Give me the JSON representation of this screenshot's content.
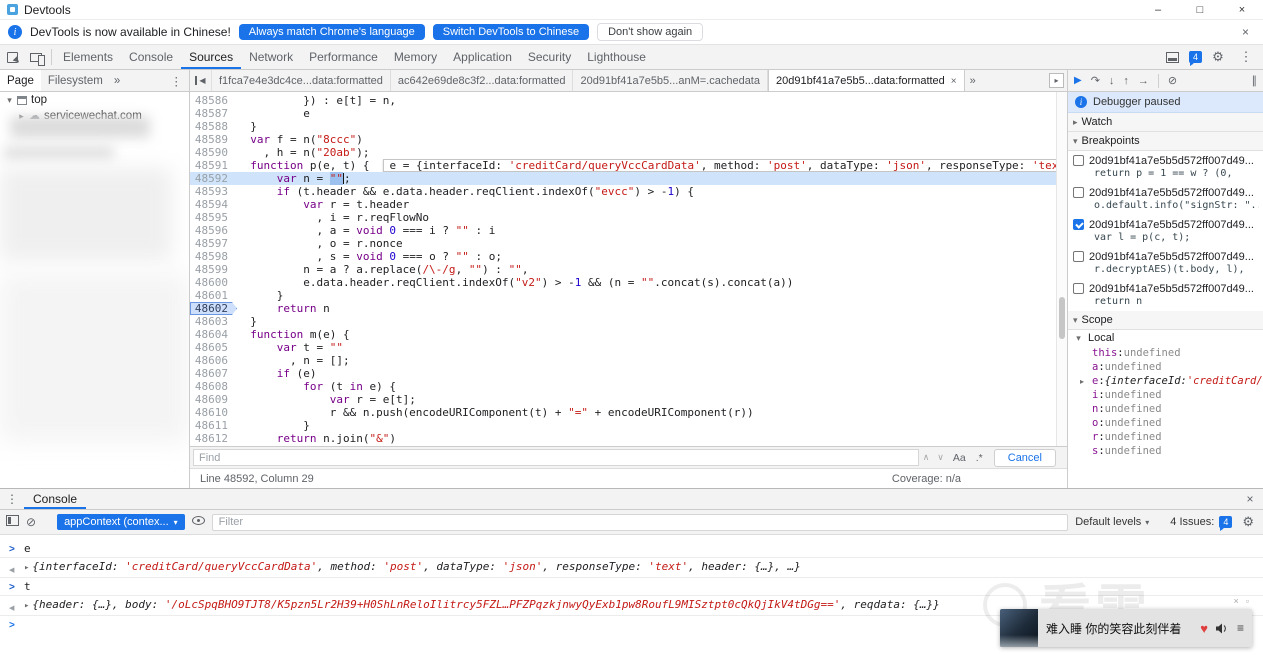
{
  "window": {
    "title": "Devtools"
  },
  "icons": {
    "info": "i",
    "window_min": "–",
    "window_max": "□",
    "window_close": "×",
    "close_small": "×",
    "gear": "⚙",
    "kebab": "⋮",
    "cloud": "☁",
    "chevron_down": "▾",
    "chevron_right": "▸",
    "hide_navigator": "◀",
    "tab_more": "▸",
    "resume": "▶",
    "step_over": "↷",
    "step_into": "↓",
    "step_out": "↑",
    "step": "→",
    "deactivate_bp": "⊘",
    "pause_exc": "∥",
    "find_prev": "∧",
    "find_next": "∨",
    "clear_console": "⊘",
    "input_marker": ">",
    "result_marker": "◀",
    "heart": "♥",
    "list": "≡",
    "player_close": "×",
    "player_expand": "▫"
  },
  "infobar": {
    "message": "DevTools is now available in Chinese!",
    "primary": "Always match Chrome's language",
    "secondary": "Switch DevTools to Chinese",
    "dismiss": "Don't show again"
  },
  "toolbar": {
    "tabs": [
      "Elements",
      "Console",
      "Sources",
      "Network",
      "Performance",
      "Memory",
      "Application",
      "Security",
      "Lighthouse"
    ],
    "selected_tab": "Sources",
    "issues_badge": "4"
  },
  "navigator": {
    "tabs": [
      "Page",
      "Filesystem"
    ],
    "overflow": "»",
    "tree": [
      {
        "label": "top",
        "expanded": true,
        "icon": "frame",
        "indent": 0
      },
      {
        "label": "servicewechat.com",
        "expanded": false,
        "icon": "cloud",
        "indent": 1
      }
    ]
  },
  "editor": {
    "tabs": [
      {
        "label": "f1fca7e4e3dc4ce...data:formatted",
        "active": false
      },
      {
        "label": "ac642e69de8c3f2...data:formatted",
        "active": false
      },
      {
        "label": "20d91bf41a7e5b5...anM=.cachedata",
        "active": false
      },
      {
        "label": "20d91bf41a7e5b5...data:formatted",
        "active": true,
        "closable": true
      }
    ],
    "overflow": "»",
    "inline_eval": [
      [
        "t",
        "e = {interfaceId: "
      ],
      [
        "s",
        "'creditCard/queryVccCardData'"
      ],
      [
        "t",
        ", method: "
      ],
      [
        "s",
        "'post'"
      ],
      [
        "t",
        ", dataType: "
      ],
      [
        "s",
        "'json'"
      ],
      [
        "t",
        ", responseType: "
      ],
      [
        "s",
        "'text'"
      ],
      [
        "t",
        ", he"
      ]
    ],
    "lines": [
      {
        "no": 48586,
        "tok": [
          [
            "t",
            "          }) : e[t] = n,"
          ]
        ]
      },
      {
        "no": 48587,
        "tok": [
          [
            "t",
            "          e"
          ]
        ]
      },
      {
        "no": 48588,
        "tok": [
          [
            "t",
            "  }"
          ]
        ]
      },
      {
        "no": 48589,
        "tok": [
          [
            "t",
            "  "
          ],
          [
            "k",
            "var"
          ],
          [
            "t",
            " f = n("
          ],
          [
            "s",
            "\"8ccc\""
          ],
          [
            "t",
            ")"
          ]
        ]
      },
      {
        "no": 48590,
        "tok": [
          [
            "t",
            "    , h = n("
          ],
          [
            "s",
            "\"20ab\""
          ],
          [
            "t",
            ");"
          ]
        ]
      },
      {
        "no": 48591,
        "eval": true,
        "tok": [
          [
            "t",
            "  "
          ],
          [
            "k",
            "function"
          ],
          [
            "t",
            " p(e, t) {"
          ]
        ]
      },
      {
        "no": 48592,
        "exec": true,
        "tok": [
          [
            "t",
            "      "
          ],
          [
            "k",
            "var"
          ],
          [
            "t",
            " n = "
          ],
          [
            "sel",
            "\"\""
          ],
          [
            "t",
            ";"
          ]
        ]
      },
      {
        "no": 48593,
        "tok": [
          [
            "t",
            "      "
          ],
          [
            "k",
            "if"
          ],
          [
            "t",
            " (t.header && e.data.header.reqClient.indexOf("
          ],
          [
            "s",
            "\"evcc\""
          ],
          [
            "t",
            ") > -"
          ],
          [
            "n",
            "1"
          ],
          [
            "t",
            ") {"
          ]
        ]
      },
      {
        "no": 48594,
        "tok": [
          [
            "t",
            "          "
          ],
          [
            "k",
            "var"
          ],
          [
            "t",
            " r = t.header"
          ]
        ]
      },
      {
        "no": 48595,
        "tok": [
          [
            "t",
            "            , i = r.reqFlowNo"
          ]
        ]
      },
      {
        "no": 48596,
        "tok": [
          [
            "t",
            "            , a = "
          ],
          [
            "k",
            "void"
          ],
          [
            "t",
            " "
          ],
          [
            "n",
            "0"
          ],
          [
            "t",
            " === i ? "
          ],
          [
            "s",
            "\"\""
          ],
          [
            "t",
            " : i"
          ]
        ]
      },
      {
        "no": 48597,
        "tok": [
          [
            "t",
            "            , o = r.nonce"
          ]
        ]
      },
      {
        "no": 48598,
        "tok": [
          [
            "t",
            "            , s = "
          ],
          [
            "k",
            "void"
          ],
          [
            "t",
            " "
          ],
          [
            "n",
            "0"
          ],
          [
            "t",
            " === o ? "
          ],
          [
            "s",
            "\"\""
          ],
          [
            "t",
            " : o;"
          ]
        ]
      },
      {
        "no": 48599,
        "tok": [
          [
            "t",
            "          n = a ? a.replace("
          ],
          [
            "r",
            "/\\-/g"
          ],
          [
            "t",
            ", "
          ],
          [
            "s",
            "\"\""
          ],
          [
            "t",
            ") : "
          ],
          [
            "s",
            "\"\""
          ],
          [
            "t",
            ","
          ]
        ]
      },
      {
        "no": 48600,
        "tok": [
          [
            "t",
            "          e.data.header.reqClient.indexOf("
          ],
          [
            "s",
            "\"v2\""
          ],
          [
            "t",
            ") > -"
          ],
          [
            "n",
            "1"
          ],
          [
            "t",
            " && (n = "
          ],
          [
            "s",
            "\"\""
          ],
          [
            "t",
            ".concat(s).concat(a))"
          ]
        ]
      },
      {
        "no": 48601,
        "tok": [
          [
            "t",
            "      }"
          ]
        ]
      },
      {
        "no": 48602,
        "bp": true,
        "tok": [
          [
            "t",
            "      "
          ],
          [
            "k",
            "return"
          ],
          [
            "t",
            " n"
          ]
        ]
      },
      {
        "no": 48603,
        "tok": [
          [
            "t",
            "  }"
          ]
        ]
      },
      {
        "no": 48604,
        "tok": [
          [
            "t",
            "  "
          ],
          [
            "k",
            "function"
          ],
          [
            "t",
            " m(e) {"
          ]
        ]
      },
      {
        "no": 48605,
        "tok": [
          [
            "t",
            "      "
          ],
          [
            "k",
            "var"
          ],
          [
            "t",
            " t = "
          ],
          [
            "s",
            "\"\""
          ]
        ]
      },
      {
        "no": 48606,
        "tok": [
          [
            "t",
            "        , n = [];"
          ]
        ]
      },
      {
        "no": 48607,
        "tok": [
          [
            "t",
            "      "
          ],
          [
            "k",
            "if"
          ],
          [
            "t",
            " (e)"
          ]
        ]
      },
      {
        "no": 48608,
        "tok": [
          [
            "t",
            "          "
          ],
          [
            "k",
            "for"
          ],
          [
            "t",
            " (t "
          ],
          [
            "k",
            "in"
          ],
          [
            "t",
            " e) {"
          ]
        ]
      },
      {
        "no": 48609,
        "tok": [
          [
            "t",
            "              "
          ],
          [
            "k",
            "var"
          ],
          [
            "t",
            " r = e[t];"
          ]
        ]
      },
      {
        "no": 48610,
        "tok": [
          [
            "t",
            "              r && n.push(encodeURIComponent(t) + "
          ],
          [
            "s",
            "\"=\""
          ],
          [
            "t",
            " + encodeURIComponent(r))"
          ]
        ]
      },
      {
        "no": 48611,
        "tok": [
          [
            "t",
            "          }"
          ]
        ]
      },
      {
        "no": 48612,
        "tok": [
          [
            "t",
            "      "
          ],
          [
            "k",
            "return"
          ],
          [
            "t",
            " n.join("
          ],
          [
            "s",
            "\"&\""
          ],
          [
            "t",
            ")"
          ]
        ]
      }
    ],
    "find": {
      "placeholder": "Find",
      "match_case": "Aa",
      "regex": ".*",
      "cancel": "Cancel"
    },
    "status": {
      "position": "Line 48592, Column 29",
      "coverage": "Coverage: n/a"
    }
  },
  "debugger": {
    "paused": "Debugger paused",
    "sections": {
      "watch": "Watch",
      "breakpoints": "Breakpoints",
      "scope": "Scope"
    },
    "breakpoints": [
      {
        "checked": false,
        "file": "20d91bf41a7e5b5d572ff007d49...",
        "code": "return p = 1 == w ? (0,"
      },
      {
        "checked": false,
        "file": "20d91bf41a7e5b5d572ff007d49...",
        "code": "o.default.info(\"signStr: \"..."
      },
      {
        "checked": true,
        "file": "20d91bf41a7e5b5d572ff007d49...",
        "code": "var l = p(c, t);"
      },
      {
        "checked": false,
        "file": "20d91bf41a7e5b5d572ff007d49...",
        "code": "r.decryptAES)(t.body, l),"
      },
      {
        "checked": false,
        "file": "20d91bf41a7e5b5d572ff007d49...",
        "code": "return n"
      }
    ],
    "scope": {
      "group": "Local",
      "vars": [
        {
          "name": "this",
          "value": "undefined"
        },
        {
          "name": "a",
          "value": "undefined"
        },
        {
          "name": "e",
          "preview": [
            [
              "p",
              "{interfaceId: "
            ],
            [
              "str",
              "'creditCard/q"
            ]
          ]
        },
        {
          "name": "i",
          "value": "undefined"
        },
        {
          "name": "n",
          "value": "undefined"
        },
        {
          "name": "o",
          "value": "undefined"
        },
        {
          "name": "r",
          "value": "undefined"
        },
        {
          "name": "s",
          "value": "undefined"
        }
      ]
    }
  },
  "console": {
    "tab": "Console",
    "context": "appContext (contex...",
    "filter_placeholder": "Filter",
    "levels": "Default levels",
    "issues_text": "4 Issues:",
    "issues_badge": "4",
    "entries": [
      {
        "kind": "input",
        "tokens": [
          [
            "cmd",
            "e"
          ]
        ]
      },
      {
        "kind": "result",
        "tokens": [
          [
            "tri",
            "▸"
          ],
          [
            "p",
            "{interfaceId: "
          ],
          [
            "str",
            "'creditCard/queryVccCardData'"
          ],
          [
            "p",
            ", method: "
          ],
          [
            "str",
            "'post'"
          ],
          [
            "p",
            ", dataType: "
          ],
          [
            "str",
            "'json'"
          ],
          [
            "p",
            ", responseType: "
          ],
          [
            "str",
            "'text'"
          ],
          [
            "p",
            ", header: {…}, …}"
          ]
        ]
      },
      {
        "kind": "input",
        "tokens": [
          [
            "cmd",
            "t"
          ]
        ]
      },
      {
        "kind": "result",
        "tokens": [
          [
            "tri",
            "▸"
          ],
          [
            "p",
            "{header: {…}, body: "
          ],
          [
            "str",
            "'/oLcSpqBHO9TJT8/K5pzn5Lr2H39+H0ShLnReloIlitrcy5FZL…PFZPqzkjnwyQyExb1pw8RoufL9MISztpt0cQkQjIkV4tDGg=='"
          ],
          [
            "p",
            ", reqdata: {…}}"
          ]
        ]
      },
      {
        "kind": "prompt",
        "tokens": []
      }
    ]
  },
  "player": {
    "title": "难入睡 你的笑容此刻伴着"
  },
  "watermark": {
    "text": "看雪"
  }
}
